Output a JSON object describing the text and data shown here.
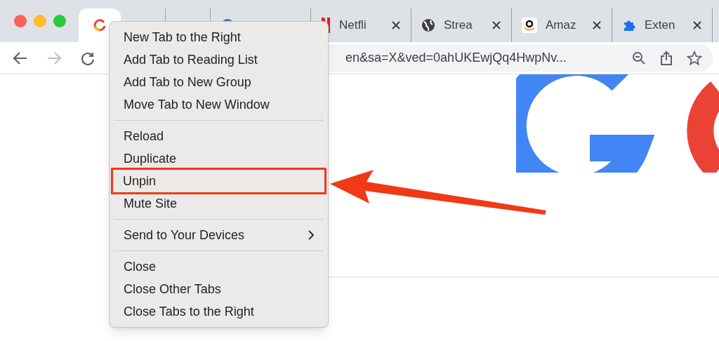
{
  "tabs": [
    {
      "kind": "pinned",
      "selected": true
    },
    {
      "kind": "pinned",
      "selected": false
    },
    {
      "kind": "pinned",
      "selected": false
    },
    {
      "kind": "normal",
      "selected": false
    },
    {
      "kind": "normal",
      "title": "Netfli",
      "selected": false
    },
    {
      "kind": "normal",
      "title": "Strea",
      "selected": false
    },
    {
      "kind": "normal",
      "title": "Amaz",
      "selected": false
    },
    {
      "kind": "normal",
      "title": "Exten",
      "selected": false
    }
  ],
  "address_bar": {
    "value": "en&sa=X&ved=0ahUKEwjQq4HwpNv..."
  },
  "context_menu": {
    "groups": [
      [
        {
          "label": "New Tab to the Right",
          "has_submenu": false,
          "annotated": false
        },
        {
          "label": "Add Tab to Reading List",
          "has_submenu": false,
          "annotated": false
        },
        {
          "label": "Add Tab to New Group",
          "has_submenu": false,
          "annotated": false
        },
        {
          "label": "Move Tab to New Window",
          "has_submenu": false,
          "annotated": false
        }
      ],
      [
        {
          "label": "Reload",
          "has_submenu": false,
          "annotated": false
        },
        {
          "label": "Duplicate",
          "has_submenu": false,
          "annotated": false
        },
        {
          "label": "Unpin",
          "has_submenu": false,
          "annotated": true
        },
        {
          "label": "Mute Site",
          "has_submenu": false,
          "annotated": false
        }
      ],
      [
        {
          "label": "Send to Your Devices",
          "has_submenu": true,
          "annotated": false
        }
      ],
      [
        {
          "label": "Close",
          "has_submenu": false,
          "annotated": false
        },
        {
          "label": "Close Other Tabs",
          "has_submenu": false,
          "annotated": false
        },
        {
          "label": "Close Tabs to the Right",
          "has_submenu": false,
          "annotated": false
        }
      ]
    ]
  }
}
